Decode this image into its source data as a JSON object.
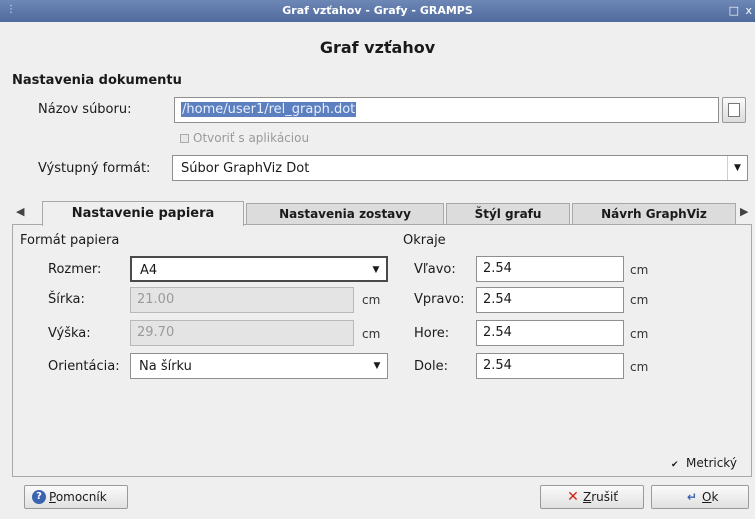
{
  "window": {
    "title": "Graf vzťahov - Grafy - GRAMPS"
  },
  "heading": "Graf vzťahov",
  "document_settings": {
    "title": "Nastavenia dokumentu",
    "filename_label": "Názov súboru:",
    "filename_value": "/home/user1/rel_graph.dot",
    "open_with_app_label": "Otvoriť s aplikáciou",
    "output_format_label": "Výstupný formát:",
    "output_format_value": "Súbor GraphViz Dot"
  },
  "tabs": [
    {
      "label": "Nastavenie papiera"
    },
    {
      "label": "Nastavenia zostavy"
    },
    {
      "label": "Štýl grafu"
    },
    {
      "label": "Návrh GraphViz"
    }
  ],
  "paper": {
    "title": "Formát papiera",
    "size_label": "Rozmer:",
    "size_value": "A4",
    "width_label": "Šírka:",
    "width_value": "21.00",
    "height_label": "Výška:",
    "height_value": "29.70",
    "orientation_label": "Orientácia:",
    "orientation_value": "Na šírku",
    "unit": "cm"
  },
  "margins": {
    "title": "Okraje",
    "left_label": "Vľavo:",
    "left_value": "2.54",
    "right_label": "Vpravo:",
    "right_value": "2.54",
    "top_label": "Hore:",
    "top_value": "2.54",
    "bottom_label": "Dole:",
    "bottom_value": "2.54",
    "unit": "cm"
  },
  "metric_label": "Metrický",
  "buttons": {
    "help": "Pomocník",
    "cancel": "Zrušiť",
    "ok": "Ok"
  },
  "colors": {
    "titlebar": "#5b76a8",
    "selection": "#5b7fbf",
    "cancel_icon": "#d0201a",
    "ok_icon": "#3a64b0"
  }
}
